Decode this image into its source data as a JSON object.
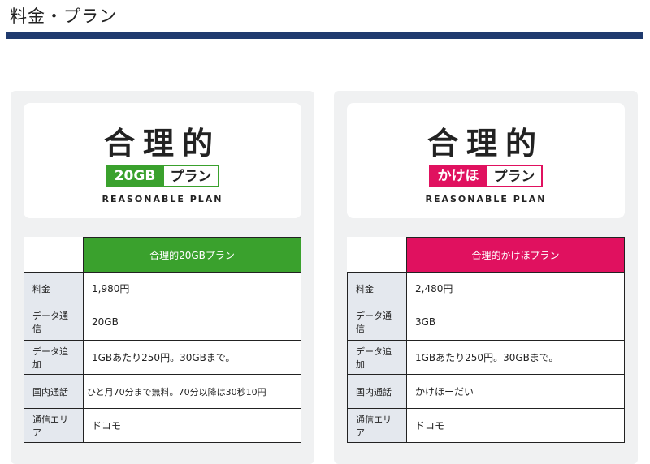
{
  "page": {
    "title": "料金・プラン"
  },
  "colors": {
    "title_bar": "#1f3a6e",
    "green": "#3aa12d",
    "pink": "#e0115f",
    "label_bg": "#e4e8ee"
  },
  "plans": [
    {
      "logo_main": "合理的",
      "logo_tag": "20GB",
      "logo_rest": "プラン",
      "logo_en": "REASONABLE PLAN",
      "header": "合理的20GBプラン",
      "rows": [
        {
          "label": "料金",
          "value": "1,980円"
        },
        {
          "label": "データ通信",
          "value": "20GB"
        },
        {
          "label": "データ追加",
          "value": "1GBあたり250円。30GBまで。"
        },
        {
          "label": "国内通話",
          "value": "ひと月70分まで無料。70分以降は30秒10円"
        },
        {
          "label": "通信エリア",
          "value": "ドコモ"
        }
      ]
    },
    {
      "logo_main": "合理的",
      "logo_tag": "かけほ",
      "logo_rest": "プラン",
      "logo_en": "REASONABLE PLAN",
      "header": "合理的かけほプラン",
      "rows": [
        {
          "label": "料金",
          "value": "2,480円"
        },
        {
          "label": "データ通信",
          "value": "3GB"
        },
        {
          "label": "データ追加",
          "value": "1GBあたり250円。30GBまで。"
        },
        {
          "label": "国内通話",
          "value": "かけほーだい"
        },
        {
          "label": "通信エリア",
          "value": "ドコモ"
        }
      ]
    }
  ]
}
